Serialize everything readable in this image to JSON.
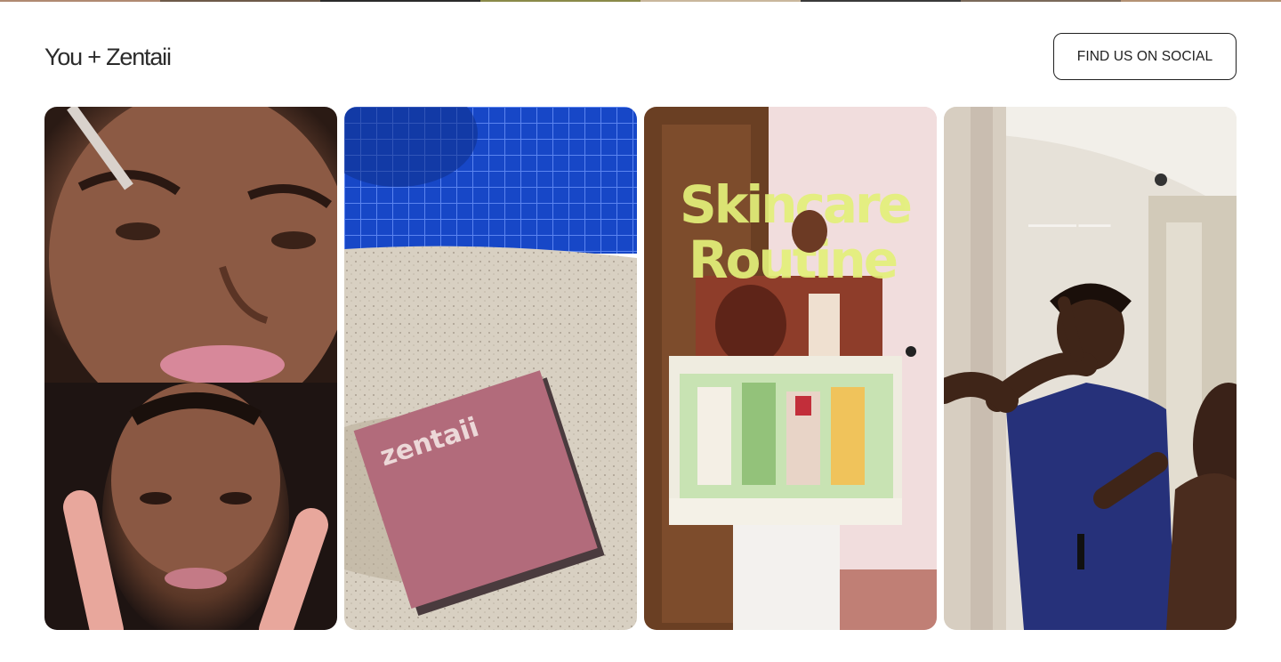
{
  "section": {
    "title": "You + Zentaii",
    "social_button_label": "FIND US ON SOCIAL"
  },
  "top_strip_colors": [
    "#b08a72",
    "#6e5a4a",
    "#2a2a2a",
    "#8a8a4a",
    "#c9b79c",
    "#3a3a3a",
    "#7a6a5a",
    "#b49274"
  ],
  "gallery": {
    "tiles": [
      {
        "kind": "split-selfie-video"
      },
      {
        "kind": "product-on-sand",
        "brand_text": "zentaii"
      },
      {
        "kind": "skincare-box-video",
        "overlay_text_line1": "Skincare",
        "overlay_text_line2": "Routine"
      },
      {
        "kind": "serum-application-video"
      }
    ]
  },
  "colors": {
    "text": "#2b2b2b",
    "button_border": "#1f1f1f",
    "background": "#ffffff"
  }
}
